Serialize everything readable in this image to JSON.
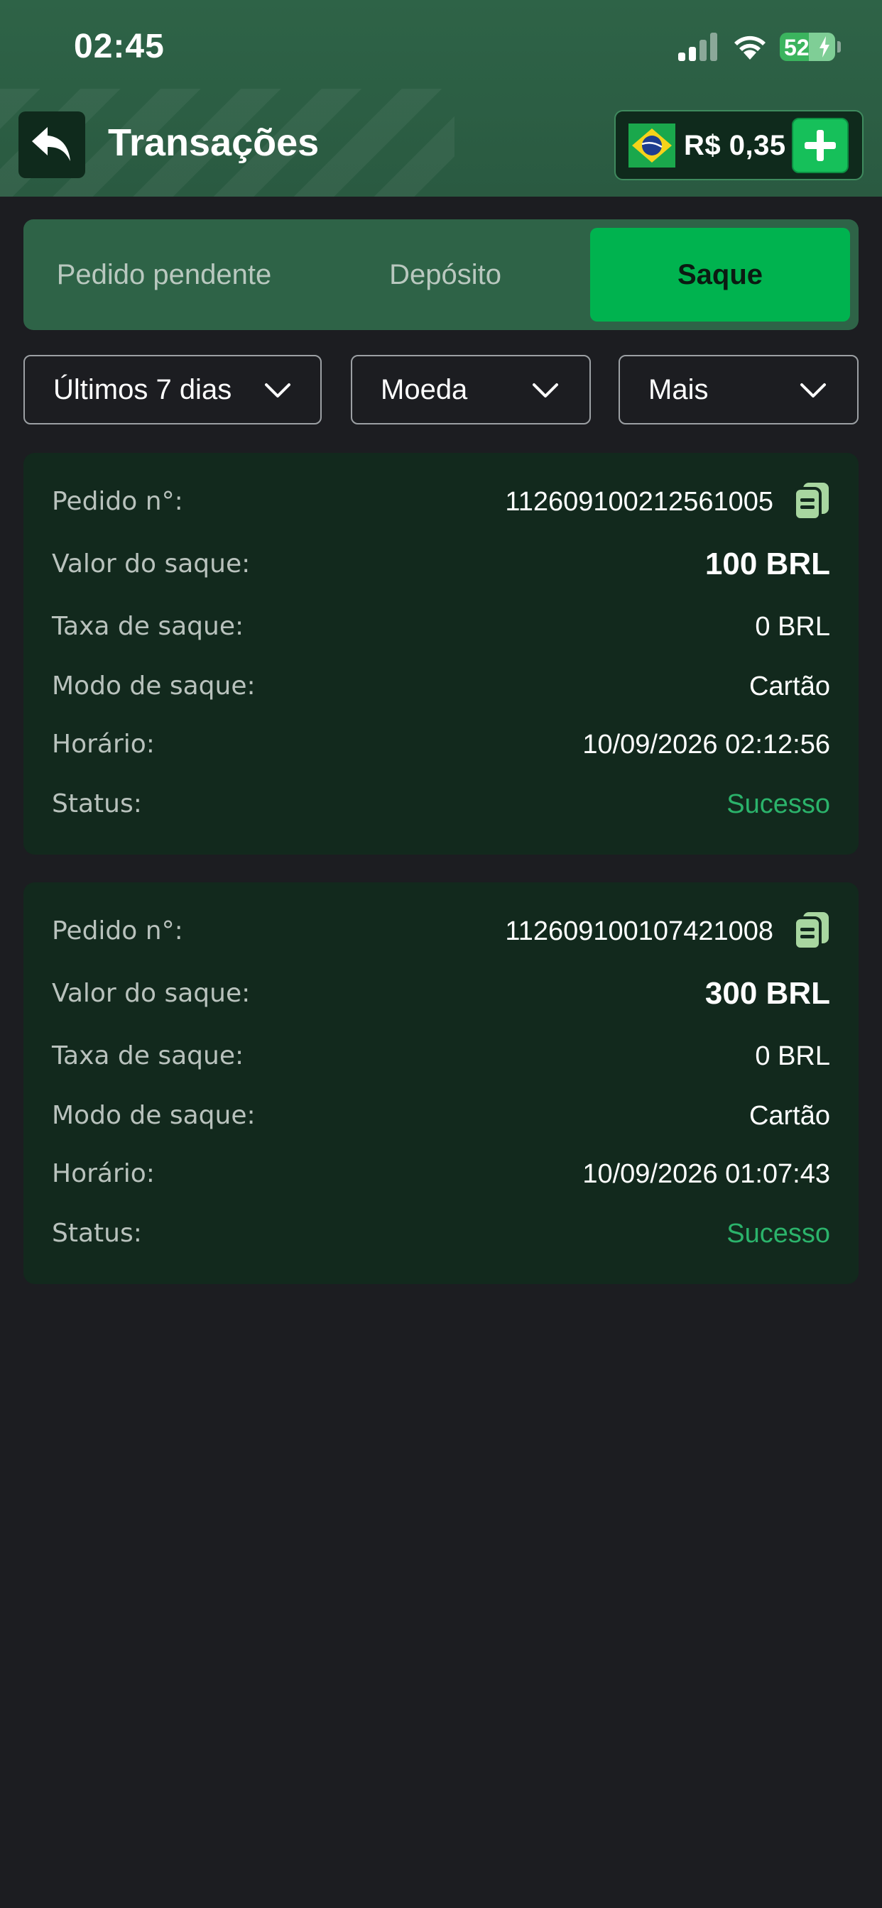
{
  "status_bar": {
    "time": "02:45",
    "battery_level": "52",
    "battery_fraction": 0.52
  },
  "header": {
    "title": "Transações",
    "balance": "R$ 0,35",
    "back_icon": "back-arrow-icon",
    "add_icon": "plus-icon",
    "flag_icon": "brazil-flag-icon"
  },
  "tabs": [
    {
      "label": "Pedido pendente",
      "active": false
    },
    {
      "label": "Depósito",
      "active": false
    },
    {
      "label": "Saque",
      "active": true
    }
  ],
  "filters": {
    "date": "Últimos 7 dias",
    "currency": "Moeda",
    "more": "Mais"
  },
  "labels": {
    "order_no": "Pedido n°:",
    "amount": "Valor do saque:",
    "fee": "Taxa de saque:",
    "mode": "Modo de saque:",
    "time": "Horário:",
    "status": "Status:"
  },
  "transactions": [
    {
      "order_no": "112609100212561005",
      "amount": "100 BRL",
      "fee": "0 BRL",
      "mode": "Cartão",
      "time": "10/09/2026 02:12:56",
      "status": "Sucesso"
    },
    {
      "order_no": "112609100107421008",
      "amount": "300 BRL",
      "fee": "0 BRL",
      "mode": "Cartão",
      "time": "10/09/2026 01:07:43",
      "status": "Sucesso"
    }
  ],
  "colors": {
    "header_bg": "#2e6347",
    "accent": "#00b34f",
    "card_bg": "#12291d",
    "success": "#2bb36b",
    "page_bg": "#1c1d21"
  }
}
